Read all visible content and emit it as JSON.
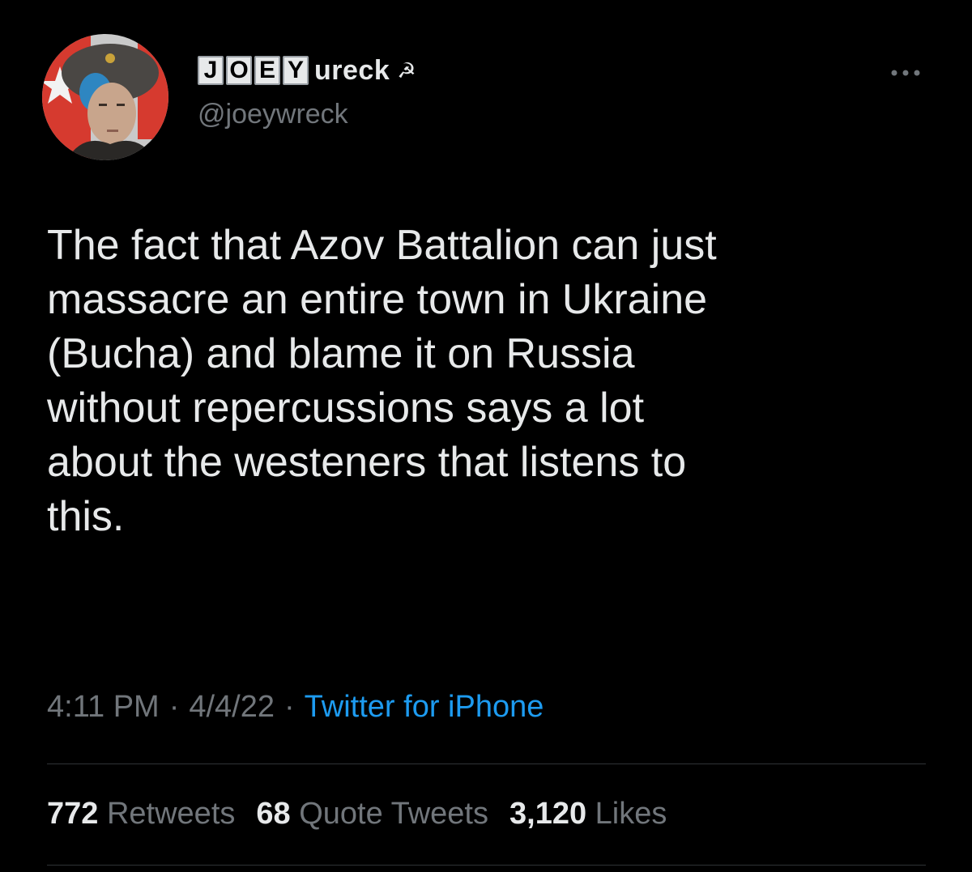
{
  "author": {
    "display_name_boxed": [
      "J",
      "O",
      "E",
      "Y"
    ],
    "display_name_tail": "ureck",
    "display_name_emoji": "☭",
    "handle": "@joeywreck",
    "avatar": "user-avatar-photo"
  },
  "more_icon": "more-horizontal-icon",
  "tweet": {
    "text": "The fact that Azov Battalion can just\nmassacre an entire town in Ukraine\n(Bucha) and blame it on Russia\nwithout repercussions says a lot\nabout the westeners that listens to\nthis."
  },
  "meta": {
    "time": "4:11 PM",
    "separator": "·",
    "date": "4/4/22",
    "source": "Twitter for iPhone"
  },
  "stats": {
    "retweets_count": "772",
    "retweets_label": "Retweets",
    "quotes_count": "68",
    "quotes_label": "Quote Tweets",
    "likes_count": "3,120",
    "likes_label": "Likes"
  },
  "colors": {
    "background": "#000000",
    "text": "#e7e9ea",
    "secondary": "#71767b",
    "link": "#1d9bf0",
    "divider": "#2f3336"
  }
}
